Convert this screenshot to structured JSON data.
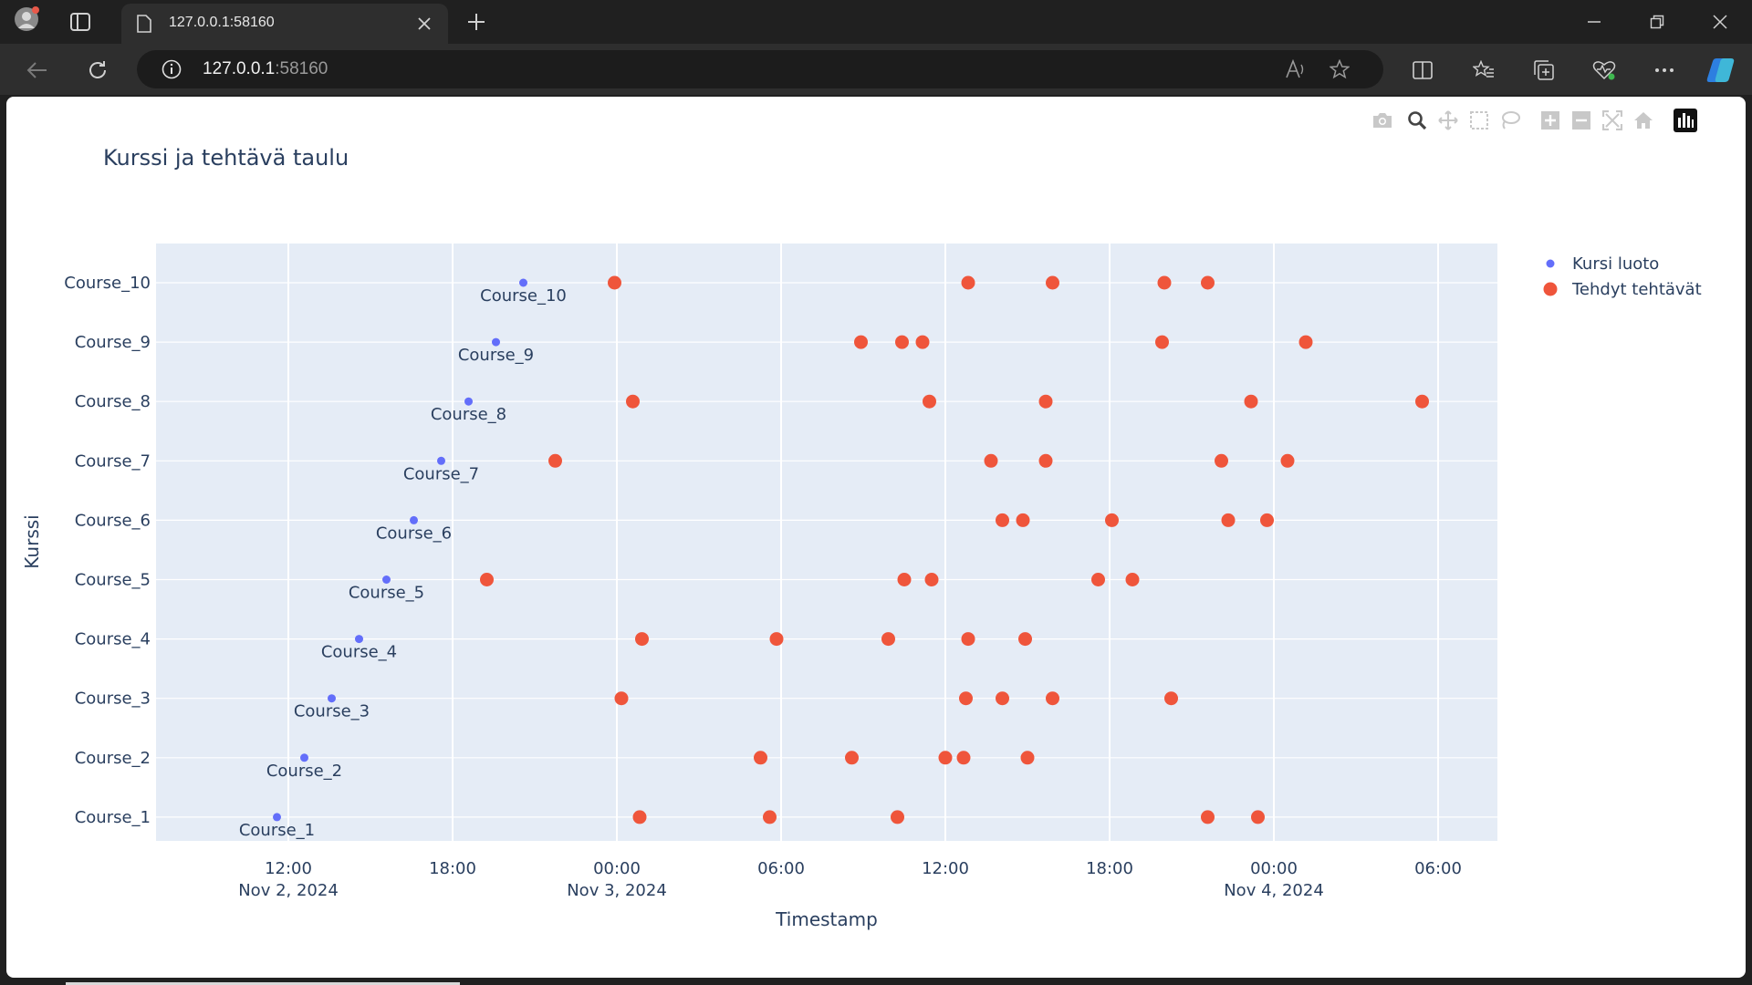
{
  "browser": {
    "tab_title": "127.0.0.1:58160",
    "url_host": "127.0.0.1",
    "url_port": ":58160"
  },
  "icons": {
    "profile": "profile-avatar-icon",
    "tab_actions": "tab-actions-icon",
    "page": "page-icon",
    "tab_close": "close-icon",
    "new_tab": "plus-icon",
    "back": "back-arrow-icon",
    "reload": "reload-icon",
    "site_info": "info-icon",
    "read_aloud": "read-aloud-icon",
    "favorite": "star-icon",
    "split": "split-screen-icon",
    "favorites": "favorites-icon",
    "collections": "collections-icon",
    "health": "browser-essentials-icon",
    "more": "more-icon",
    "copilot": "copilot-icon",
    "modebar": [
      "camera-icon",
      "zoom-icon",
      "pan-icon",
      "box-select-icon",
      "lasso-icon",
      "zoom-in-icon",
      "zoom-out-icon",
      "autoscale-icon",
      "reset-axes-icon",
      "plotly-logo-icon"
    ]
  },
  "colors": {
    "created": "#636efa",
    "done": "#ef553b",
    "plot_bg": "#e5ecf6",
    "text": "#2a3f5f"
  },
  "chart_data": {
    "type": "scatter",
    "title": "Kurssi ja tehtävä taulu",
    "xlabel": "Timestamp",
    "ylabel": "Kurssi",
    "categories": [
      "Course_1",
      "Course_2",
      "Course_3",
      "Course_4",
      "Course_5",
      "Course_6",
      "Course_7",
      "Course_8",
      "Course_9",
      "Course_10"
    ],
    "xlim": [
      "2024-11-02 07:10",
      "2024-11-04 08:10"
    ],
    "x_ticks": [
      {
        "t": "2024-11-02 12:00",
        "line1": "12:00",
        "line2": "Nov 2, 2024"
      },
      {
        "t": "2024-11-02 18:00",
        "line1": "18:00",
        "line2": ""
      },
      {
        "t": "2024-11-03 00:00",
        "line1": "00:00",
        "line2": "Nov 3, 2024"
      },
      {
        "t": "2024-11-03 06:00",
        "line1": "06:00",
        "line2": ""
      },
      {
        "t": "2024-11-03 12:00",
        "line1": "12:00",
        "line2": ""
      },
      {
        "t": "2024-11-03 18:00",
        "line1": "18:00",
        "line2": ""
      },
      {
        "t": "2024-11-04 00:00",
        "line1": "00:00",
        "line2": "Nov 4, 2024"
      },
      {
        "t": "2024-11-04 06:00",
        "line1": "06:00",
        "line2": ""
      }
    ],
    "grid": true,
    "legend_position": "top-right",
    "series": [
      {
        "name": "Kursi luoto",
        "mode": "markers+text",
        "points": [
          {
            "y": "Course_1",
            "x": "2024-11-02 11:35",
            "text": "Course_1"
          },
          {
            "y": "Course_2",
            "x": "2024-11-02 12:35",
            "text": "Course_2"
          },
          {
            "y": "Course_3",
            "x": "2024-11-02 13:35",
            "text": "Course_3"
          },
          {
            "y": "Course_4",
            "x": "2024-11-02 14:35",
            "text": "Course_4"
          },
          {
            "y": "Course_5",
            "x": "2024-11-02 15:35",
            "text": "Course_5"
          },
          {
            "y": "Course_6",
            "x": "2024-11-02 16:35",
            "text": "Course_6"
          },
          {
            "y": "Course_7",
            "x": "2024-11-02 17:35",
            "text": "Course_7"
          },
          {
            "y": "Course_8",
            "x": "2024-11-02 18:35",
            "text": "Course_8"
          },
          {
            "y": "Course_9",
            "x": "2024-11-02 19:35",
            "text": "Course_9"
          },
          {
            "y": "Course_10",
            "x": "2024-11-02 20:35",
            "text": "Course_10"
          }
        ]
      },
      {
        "name": "Tehdyt tehtävät",
        "mode": "markers",
        "points": [
          {
            "y": "Course_1",
            "x": "2024-11-03 00:50"
          },
          {
            "y": "Course_1",
            "x": "2024-11-03 05:35"
          },
          {
            "y": "Course_1",
            "x": "2024-11-03 10:15"
          },
          {
            "y": "Course_1",
            "x": "2024-11-03 21:35"
          },
          {
            "y": "Course_1",
            "x": "2024-11-03 23:25"
          },
          {
            "y": "Course_2",
            "x": "2024-11-03 05:15"
          },
          {
            "y": "Course_2",
            "x": "2024-11-03 08:35"
          },
          {
            "y": "Course_2",
            "x": "2024-11-03 12:00"
          },
          {
            "y": "Course_2",
            "x": "2024-11-03 12:40"
          },
          {
            "y": "Course_2",
            "x": "2024-11-03 15:00"
          },
          {
            "y": "Course_3",
            "x": "2024-11-03 00:10"
          },
          {
            "y": "Course_3",
            "x": "2024-11-03 12:45"
          },
          {
            "y": "Course_3",
            "x": "2024-11-03 14:05"
          },
          {
            "y": "Course_3",
            "x": "2024-11-03 15:55"
          },
          {
            "y": "Course_3",
            "x": "2024-11-03 20:15"
          },
          {
            "y": "Course_4",
            "x": "2024-11-03 00:55"
          },
          {
            "y": "Course_4",
            "x": "2024-11-03 05:50"
          },
          {
            "y": "Course_4",
            "x": "2024-11-03 09:55"
          },
          {
            "y": "Course_4",
            "x": "2024-11-03 12:50"
          },
          {
            "y": "Course_4",
            "x": "2024-11-03 14:55"
          },
          {
            "y": "Course_5",
            "x": "2024-11-02 19:15"
          },
          {
            "y": "Course_5",
            "x": "2024-11-03 10:30"
          },
          {
            "y": "Course_5",
            "x": "2024-11-03 11:30"
          },
          {
            "y": "Course_5",
            "x": "2024-11-03 17:35"
          },
          {
            "y": "Course_5",
            "x": "2024-11-03 18:50"
          },
          {
            "y": "Course_6",
            "x": "2024-11-03 14:05"
          },
          {
            "y": "Course_6",
            "x": "2024-11-03 14:50"
          },
          {
            "y": "Course_6",
            "x": "2024-11-03 18:05"
          },
          {
            "y": "Course_6",
            "x": "2024-11-03 22:20"
          },
          {
            "y": "Course_6",
            "x": "2024-11-03 23:45"
          },
          {
            "y": "Course_7",
            "x": "2024-11-02 21:45"
          },
          {
            "y": "Course_7",
            "x": "2024-11-03 13:40"
          },
          {
            "y": "Course_7",
            "x": "2024-11-03 15:40"
          },
          {
            "y": "Course_7",
            "x": "2024-11-03 22:05"
          },
          {
            "y": "Course_7",
            "x": "2024-11-04 00:30"
          },
          {
            "y": "Course_8",
            "x": "2024-11-03 00:35"
          },
          {
            "y": "Course_8",
            "x": "2024-11-03 11:25"
          },
          {
            "y": "Course_8",
            "x": "2024-11-03 15:40"
          },
          {
            "y": "Course_8",
            "x": "2024-11-03 23:10"
          },
          {
            "y": "Course_8",
            "x": "2024-11-04 05:25"
          },
          {
            "y": "Course_9",
            "x": "2024-11-03 08:55"
          },
          {
            "y": "Course_9",
            "x": "2024-11-03 10:25"
          },
          {
            "y": "Course_9",
            "x": "2024-11-03 11:10"
          },
          {
            "y": "Course_9",
            "x": "2024-11-03 19:55"
          },
          {
            "y": "Course_9",
            "x": "2024-11-04 01:10"
          },
          {
            "y": "Course_10",
            "x": "2024-11-02 23:55"
          },
          {
            "y": "Course_10",
            "x": "2024-11-03 12:50"
          },
          {
            "y": "Course_10",
            "x": "2024-11-03 15:55"
          },
          {
            "y": "Course_10",
            "x": "2024-11-03 20:00"
          },
          {
            "y": "Course_10",
            "x": "2024-11-03 21:35"
          }
        ]
      }
    ]
  }
}
